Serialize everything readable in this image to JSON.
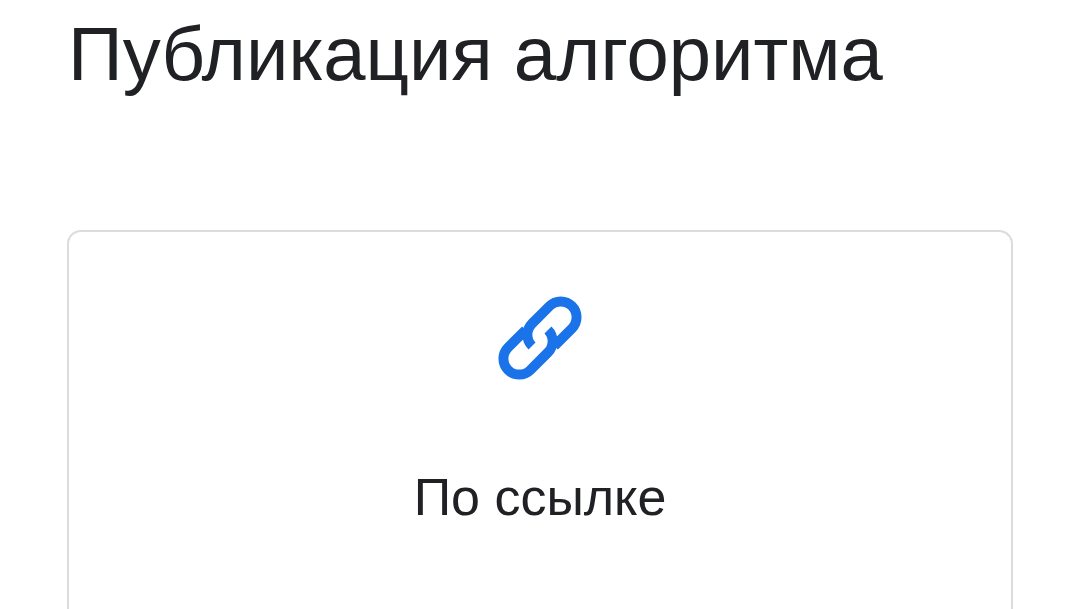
{
  "title": "Публикация алгоритма",
  "options": [
    {
      "kind": "link",
      "label": "По ссылке"
    }
  ]
}
